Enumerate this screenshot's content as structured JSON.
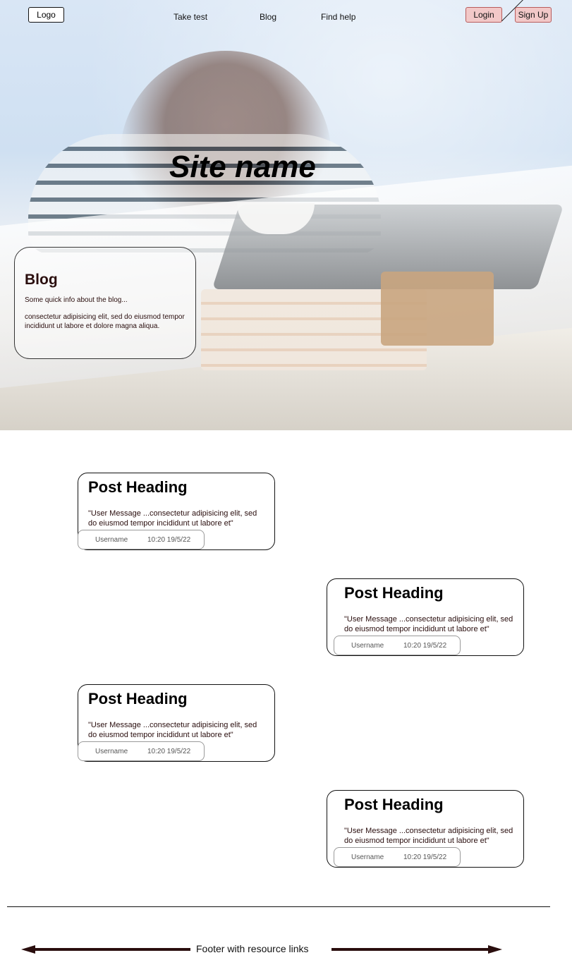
{
  "nav": {
    "logo": "Logo",
    "links": [
      "Take test",
      "Blog",
      "Find help"
    ],
    "login": "Login",
    "signup": "Sign Up"
  },
  "hero": {
    "site_name": "Site name",
    "blog": {
      "title": "Blog",
      "info": "Some quick info about the blog...",
      "text": " consectetur adipisicing elit, sed do eiusmod tempor incididunt ut labore et dolore magna aliqua."
    }
  },
  "posts": [
    {
      "heading": "Post Heading",
      "message": "\"User Message ...consectetur adipisicing elit, sed do eiusmod tempor incididunt ut labore et\"",
      "username": "Username",
      "time": "10:20 19/5/22"
    },
    {
      "heading": "Post Heading",
      "message": "\"User Message ...consectetur adipisicing elit, sed do eiusmod tempor incididunt ut labore et\"",
      "username": "Username",
      "time": "10:20 19/5/22"
    },
    {
      "heading": "Post Heading",
      "message": "\"User Message ...consectetur adipisicing elit, sed do eiusmod tempor incididunt ut labore et\"",
      "username": "Username",
      "time": "10:20 19/5/22"
    },
    {
      "heading": "Post Heading",
      "message": "\"User Message ...consectetur adipisicing elit, sed do eiusmod tempor incididunt ut labore et\"",
      "username": "Username",
      "time": "10:20 19/5/22"
    }
  ],
  "footer": {
    "text": "Footer with resource links"
  },
  "colors": {
    "auth_button_bg": "#f2c8c8",
    "accent_text": "#2a0e0e"
  }
}
